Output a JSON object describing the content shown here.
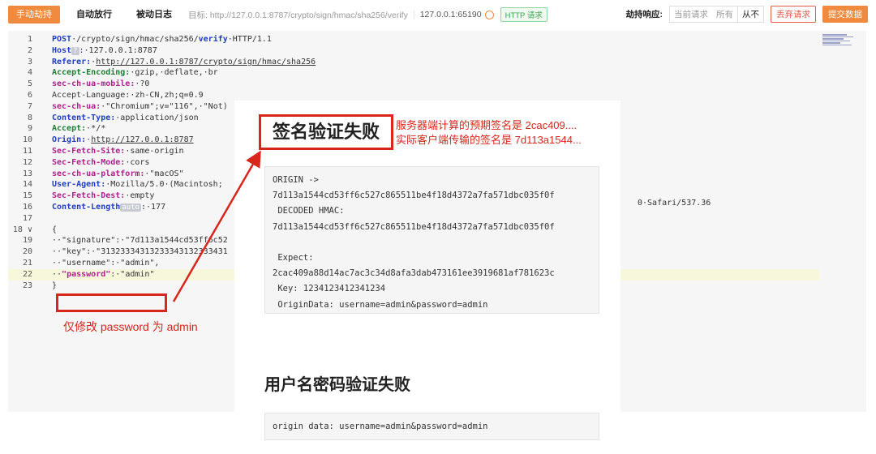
{
  "toolbar": {
    "tabs": [
      "手动劫持",
      "自动放行",
      "被动日志"
    ],
    "target_label": "目标: http://127.0.0.1:8787/crypto/sign/hmac/sha256/verify",
    "host": "127.0.0.1:65190",
    "http_badge": "HTTP 请求",
    "hijack_label": "劫持响应:",
    "hijack_options": [
      "当前请求",
      "所有",
      "从不"
    ],
    "drop_button": "丢弃请求",
    "submit_button": "提交数据"
  },
  "request": {
    "lines": [
      {
        "n": "1",
        "parts": [
          [
            "k",
            "POST"
          ],
          [
            "v",
            "·/crypto/sign/hmac/sha256/"
          ],
          [
            "vf",
            "verify"
          ],
          [
            "v",
            "·HTTP/1.1"
          ]
        ]
      },
      {
        "n": "2",
        "parts": [
          [
            "k",
            "Host"
          ],
          [
            "badge",
            "?"
          ],
          [
            "v",
            ":·127.0.0.1:8787"
          ]
        ]
      },
      {
        "n": "3",
        "parts": [
          [
            "k",
            "Referer:"
          ],
          [
            "v",
            "·"
          ],
          [
            "u",
            "http://127.0.0.1:8787/crypto/sign/hmac/sha256"
          ]
        ]
      },
      {
        "n": "4",
        "parts": [
          [
            "kg",
            "Accept-Encoding:"
          ],
          [
            "v",
            "·gzip,·deflate,·br"
          ]
        ]
      },
      {
        "n": "5",
        "parts": [
          [
            "kp",
            "sec-ch-ua-mobile:"
          ],
          [
            "v",
            "·?0"
          ]
        ]
      },
      {
        "n": "6",
        "parts": [
          [
            "v",
            "Accept-Language:·zh-CN,zh;q=0.9"
          ]
        ]
      },
      {
        "n": "7",
        "parts": [
          [
            "kp",
            "sec-ch-ua:"
          ],
          [
            "v",
            "·\"Chromium\";v=\"116\",·\"Not)"
          ]
        ]
      },
      {
        "n": "8",
        "parts": [
          [
            "k",
            "Content-Type:"
          ],
          [
            "v",
            "·application/json"
          ]
        ]
      },
      {
        "n": "9",
        "parts": [
          [
            "kg",
            "Accept:"
          ],
          [
            "v",
            "·*/*"
          ]
        ]
      },
      {
        "n": "10",
        "parts": [
          [
            "k",
            "Origin:"
          ],
          [
            "v",
            "·"
          ],
          [
            "u",
            "http://127.0.0.1:8787"
          ]
        ]
      },
      {
        "n": "11",
        "parts": [
          [
            "kp",
            "Sec-Fetch-Site:"
          ],
          [
            "v",
            "·same-origin"
          ]
        ]
      },
      {
        "n": "12",
        "parts": [
          [
            "kp",
            "Sec-Fetch-Mode:"
          ],
          [
            "v",
            "·cors"
          ]
        ]
      },
      {
        "n": "13",
        "parts": [
          [
            "kp",
            "sec-ch-ua-platform:"
          ],
          [
            "v",
            "·\"macOS\""
          ]
        ]
      },
      {
        "n": "14",
        "parts": [
          [
            "k",
            "User-Agent:"
          ],
          [
            "v",
            "·Mozilla/5.0·(Macintosh;"
          ]
        ]
      },
      {
        "n": "15",
        "parts": [
          [
            "kp",
            "Sec-Fetch-Dest:"
          ],
          [
            "v",
            "·empty"
          ]
        ]
      },
      {
        "n": "16",
        "parts": [
          [
            "k",
            "Content-Length"
          ],
          [
            "badge",
            "auto"
          ],
          [
            "v",
            ":·177"
          ]
        ]
      },
      {
        "n": "17",
        "parts": []
      },
      {
        "n": "18 ∨",
        "parts": [
          [
            "v",
            "{"
          ]
        ]
      },
      {
        "n": "19",
        "parts": [
          [
            "v",
            "··\"signature\":·\"7d113a1544cd53ff6c52"
          ]
        ]
      },
      {
        "n": "20",
        "parts": [
          [
            "v",
            "··\"key\":·\"31323334313233343132333431"
          ]
        ]
      },
      {
        "n": "21",
        "parts": [
          [
            "v",
            "··\"username\":·\"admin\","
          ]
        ]
      },
      {
        "n": "22",
        "parts": [
          [
            "v",
            "··"
          ],
          [
            "kp",
            "\"password\""
          ],
          [
            "v",
            ":·\"admin\""
          ]
        ]
      },
      {
        "n": "23",
        "parts": [
          [
            "v",
            "}"
          ]
        ]
      }
    ],
    "ua_tail": "0·Safari/537.36"
  },
  "panel": {
    "title1": "签名验证失败",
    "code1": [
      "ORIGIN ->",
      "7d113a1544cd53ff6c527c865511be4f18d4372a7fa571dbc035f0f",
      " DECODED HMAC:",
      "7d113a1544cd53ff6c527c865511be4f18d4372a7fa571dbc035f0f",
      "",
      " Expect:",
      "2cac409a88d14ac7ac3c34d8afa3dab473161ee3919681af781623c",
      " Key: 1234123412341234",
      " OriginData: username=admin&password=admin"
    ],
    "title2": "用户名密码验证失败",
    "code2": "origin data: username=admin&password=admin"
  },
  "annotations": {
    "right_line1": "服务器端计算的预期签名是 2cac409....",
    "right_line2": "实际客户端传输的签名是 7d113a1544...",
    "bottom": "仅修改 password 为 admin"
  },
  "colors": {
    "accent": "#f08a3e",
    "annotation": "#d8261c",
    "http_green": "#3aa14f"
  }
}
